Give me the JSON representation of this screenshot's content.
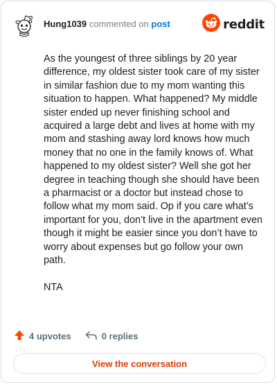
{
  "comment": {
    "username": "Hung1039",
    "action_text": "commented on",
    "post_link_label": "post",
    "brand_name": "reddit",
    "paragraphs": [
      "As the youngest of three siblings by 20 year difference, my oldest sister took care of my sister in similar fashion due to my mom wanting this situation to happen. What happened? My middle sister ended up never finishing school and acquired a large debt and lives at home with my mom and stashing away lord knows how much money that no one in the family knows of. What happened to my oldest sister? Well she got her degree in teaching though she should have been a pharmacist or a doctor but instead chose to follow what my mom said. Op if you care what’s important for you, don’t live in the apartment even though it might be easier since you don’t have to worry about expenses but go follow your own path.",
      "NTA"
    ]
  },
  "stats": {
    "upvotes_label": "4 upvotes",
    "replies_label": "0 replies"
  },
  "cta": {
    "label": "View the conversation"
  },
  "colors": {
    "accent": "#d93a00",
    "link": "#0079d3",
    "brand": "#ff4500",
    "upvote": "#ff4500"
  },
  "icons": {
    "avatar": "snoo-avatar-icon",
    "brand": "reddit-logo-icon",
    "upvote": "upvote-arrow-icon",
    "reply": "reply-arrow-icon"
  }
}
